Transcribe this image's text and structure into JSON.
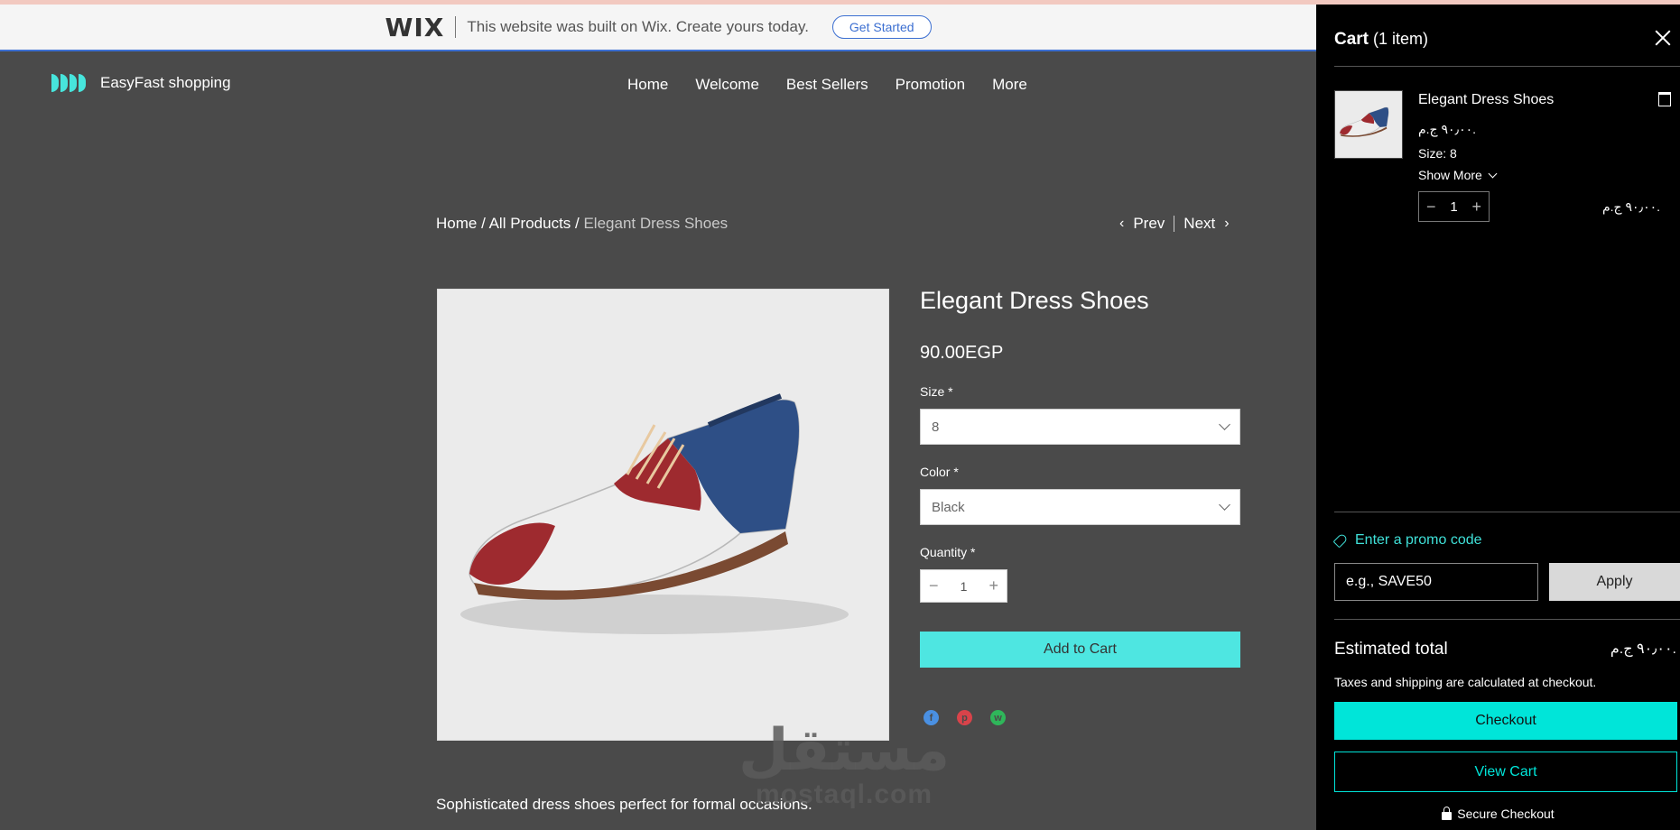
{
  "wix_banner": {
    "logo": "WIX",
    "text": "This website was built on Wix. Create yours today.",
    "cta": "Get Started"
  },
  "header": {
    "brand": "EasyFast shopping",
    "nav": [
      "Home",
      "Welcome",
      "Best Sellers",
      "Promotion",
      "More"
    ]
  },
  "breadcrumb": {
    "home": "Home",
    "sep1": " / ",
    "all_products": "All Products",
    "sep2": " / ",
    "current": "Elegant Dress Shoes"
  },
  "pager": {
    "prev": "Prev",
    "next": "Next"
  },
  "product": {
    "title": "Elegant Dress Shoes",
    "price": "90.00EGP",
    "size_label": "Size *",
    "size_value": "8",
    "color_label": "Color *",
    "color_value": "Black",
    "quantity_label": "Quantity *",
    "quantity": "1",
    "add_to_cart": "Add to Cart",
    "description": "Sophisticated dress shoes perfect for formal occasions."
  },
  "watermark": {
    "arabic": "مستقل",
    "latin": "mostaql.com"
  },
  "cart": {
    "title": "Cart",
    "count": "(1 item)",
    "item": {
      "name": "Elegant Dress Shoes",
      "price": "٩٠٫٠٠ ج.م.",
      "size": "Size: 8",
      "show_more": "Show More",
      "quantity": "1",
      "line_total": "٩٠٫٠٠ ج.م."
    },
    "promo_link": "Enter a promo code",
    "promo_placeholder": "e.g., SAVE50",
    "apply": "Apply",
    "estimated_label": "Estimated total",
    "estimated_value": "٩٠٫٠٠ ج.م.",
    "tax_note": "Taxes and shipping are calculated at checkout.",
    "checkout": "Checkout",
    "view_cart": "View Cart",
    "secure": "Secure Checkout"
  },
  "colors": {
    "accent": "#4ee6e1",
    "page_bg": "#4a4a4a",
    "cart_bg": "#000000"
  }
}
